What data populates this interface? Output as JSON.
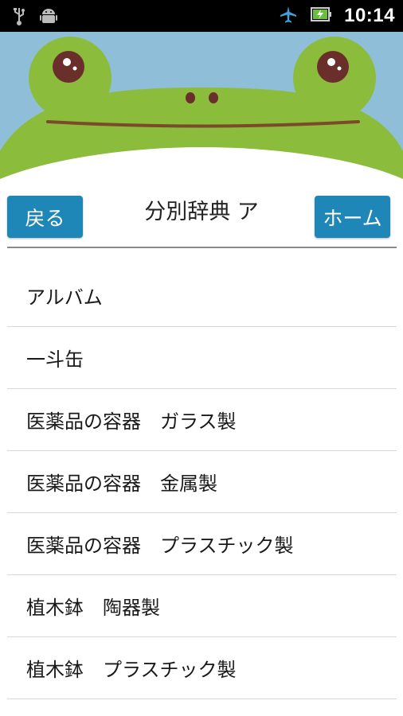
{
  "status_bar": {
    "time": "10:14",
    "icons_left": [
      "usb-icon",
      "android-debug-icon"
    ],
    "icons_right": [
      "airplane-mode-icon",
      "battery-charging-icon"
    ]
  },
  "header": {
    "back_label": "戻る",
    "title": "分別辞典 ア",
    "home_label": "ホーム"
  },
  "list": {
    "items": [
      "アルバム",
      "一斗缶",
      "医薬品の容器　ガラス製",
      "医薬品の容器　金属製",
      "医薬品の容器　プラスチック製",
      "植木鉢　陶器製",
      "植木鉢　プラスチック製"
    ]
  },
  "colors": {
    "status_bg": "#000000",
    "sky": "#8fbfd8",
    "frog_green": "#8cbc3c",
    "frog_mouth": "#7a4a2a",
    "button_bg": "#1f86b8",
    "divider": "#8a8a8a"
  }
}
